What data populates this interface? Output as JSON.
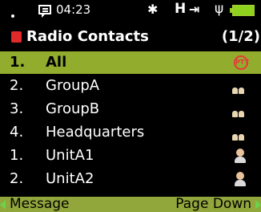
{
  "status": {
    "time": "04:23",
    "icons": [
      "message-icon",
      "bluetooth-icon",
      "h-icon",
      "transfer-icon",
      "antenna-icon",
      "battery-icon"
    ]
  },
  "header": {
    "title": "Radio Contacts",
    "page": "(1/2)"
  },
  "contacts": [
    {
      "num": "1.",
      "name": "All",
      "icon": "ptt-icon",
      "selected": true
    },
    {
      "num": "2.",
      "name": "GroupA",
      "icon": "group-icon",
      "selected": false
    },
    {
      "num": "3.",
      "name": "GroupB",
      "icon": "group-icon",
      "selected": false
    },
    {
      "num": "4.",
      "name": "Headquarters",
      "icon": "group-icon",
      "selected": false
    },
    {
      "num": "1.",
      "name": "UnitA1",
      "icon": "user-icon",
      "selected": false
    },
    {
      "num": "2.",
      "name": "UnitA2",
      "icon": "user-icon",
      "selected": false
    }
  ],
  "softkeys": {
    "left": "Message",
    "right": "Page Down"
  },
  "colors": {
    "selection": "#92ad2e",
    "softkey_bar": "#91a63b",
    "accent_red": "#e02a2a"
  }
}
